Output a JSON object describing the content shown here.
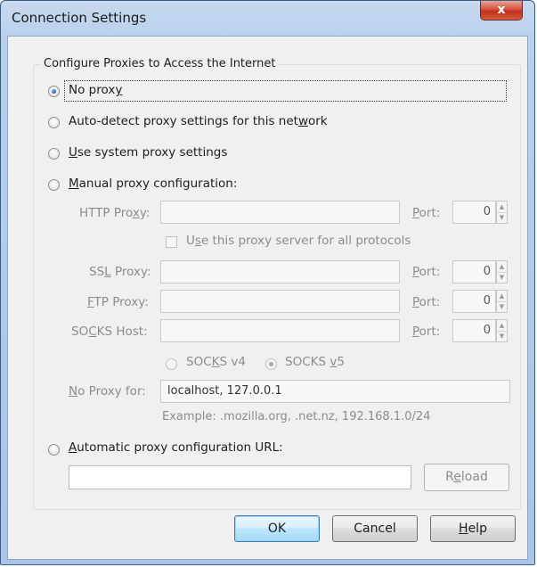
{
  "window": {
    "title": "Connection Settings",
    "close_label": "x"
  },
  "group": {
    "title": "Configure Proxies to Access the Internet"
  },
  "options": {
    "no_proxy": {
      "pre": "No prox",
      "u": "y",
      "post": ""
    },
    "auto_detect": {
      "pre": "Auto-detect proxy settings for this net",
      "u": "w",
      "post": "ork"
    },
    "system": {
      "pre": "",
      "u": "U",
      "post": "se system proxy settings"
    },
    "manual": {
      "pre": "",
      "u": "M",
      "post": "anual proxy configuration:"
    },
    "auto_url": {
      "pre": "",
      "u": "A",
      "post": "utomatic proxy configuration URL:"
    }
  },
  "manual": {
    "http": {
      "pre": "HTTP Pro",
      "u": "x",
      "post": "y:",
      "value": "",
      "port": "0"
    },
    "use_all": {
      "pre": "U",
      "u": "s",
      "post": "e this proxy server for all protocols"
    },
    "ssl": {
      "pre": "SS",
      "u": "L",
      "post": " Proxy:",
      "value": "",
      "port": "0"
    },
    "ftp": {
      "pre": "",
      "u": "F",
      "post": "TP Proxy:",
      "value": "",
      "port": "0"
    },
    "socks": {
      "pre": "SO",
      "u": "C",
      "post": "KS Host:",
      "value": "",
      "port": "0"
    },
    "port_label": {
      "pre": "",
      "u": "P",
      "post": "ort:"
    },
    "socks_v4": {
      "pre": "SOC",
      "u": "K",
      "post": "S v4"
    },
    "socks_v5": {
      "pre": "SOCKS ",
      "u": "v",
      "post": "5"
    },
    "no_proxy_for": {
      "pre": "",
      "u": "N",
      "post": "o Proxy for:",
      "value": "localhost, 127.0.0.1"
    },
    "example": "Example: .mozilla.org, .net.nz, 192.168.1.0/24"
  },
  "auto_url_field": {
    "value": ""
  },
  "buttons": {
    "reload": {
      "pre": "R",
      "u": "e",
      "post": "load"
    },
    "ok": "OK",
    "cancel": "Cancel",
    "help": {
      "pre": "",
      "u": "H",
      "post": "elp"
    }
  },
  "state": {
    "selected_option": "no_proxy",
    "socks_version": "v5"
  }
}
